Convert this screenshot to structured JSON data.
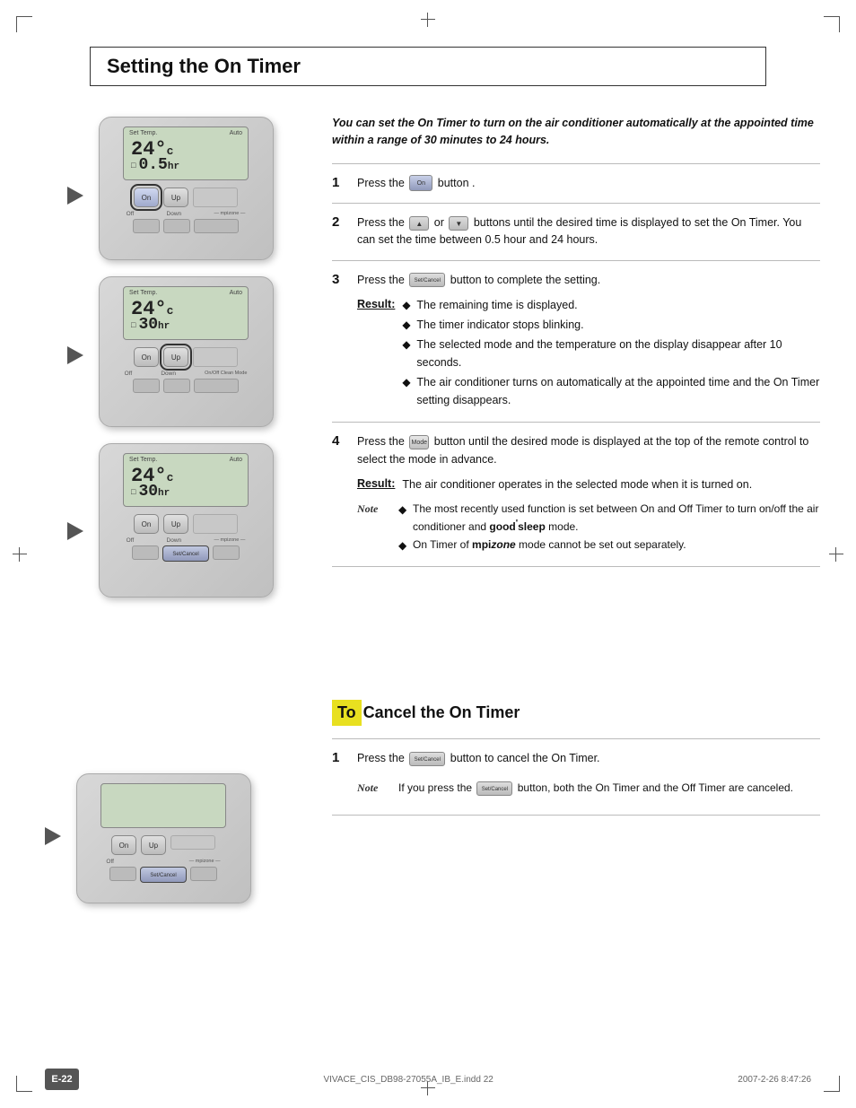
{
  "page": {
    "title": "Setting the On Timer",
    "page_number": "E-22",
    "footer_file": "VIVACE_CIS_DB98-27055A_IB_E.indd  22",
    "footer_date": "2007-2-26  8:47:26"
  },
  "intro": {
    "text": "You can set the On Timer to turn on the air conditioner automatically at the appointed time within a range of 30 minutes to 24 hours."
  },
  "steps": [
    {
      "num": "1",
      "text": "Press the",
      "button_label": "On",
      "text_after": "button ."
    },
    {
      "num": "2",
      "text_before": "Press the",
      "btn1": "Up",
      "text_or": "or",
      "btn2": "Dn",
      "text_after": "buttons until the desired time is displayed to set the On Timer. You can set the time between 0.5 hour and 24 hours."
    },
    {
      "num": "3",
      "text_before": "Press the",
      "btn": "Set/Cancel",
      "text_after": "button to complete the setting.",
      "result_label": "Result:",
      "result_bullets": [
        "The remaining time is displayed.",
        "The timer indicator stops blinking.",
        "The selected mode and the temperature on the display disappear after 10 seconds.",
        "The air conditioner turns on automatically at the appointed time and the On Timer setting disappears."
      ]
    },
    {
      "num": "4",
      "text_before": "Press the",
      "btn": "Mode",
      "text_after": "button until the desired mode is displayed at the top of the remote control to select the mode in advance.",
      "result_label": "Result:",
      "result_text": "The air conditioner operates in the selected mode when it is turned on.",
      "note_label": "Note",
      "note_bullets": [
        "The most recently used function is set between On and Off Timer to turn on/off the air conditioner and good'sleep mode.",
        "On Timer of mpizone mode cannot be set out separately."
      ]
    }
  ],
  "cancel_section": {
    "title_to": "To",
    "title_rest": "Cancel the On Timer",
    "steps": [
      {
        "num": "1",
        "text_before": "Press the",
        "btn": "Set/Cancel",
        "text_after": "button to cancel the On Timer.",
        "note_label": "Note",
        "note_text": "If you press the",
        "note_btn": "Set/Cancel",
        "note_text2": "button, both the On Timer and the Off Timer are canceled."
      }
    ]
  },
  "remote_screens": [
    {
      "id": "remote1",
      "temp": "24°c",
      "timer": "0.5hr",
      "highlight": "on-btn"
    },
    {
      "id": "remote2",
      "temp": "24°c",
      "timer": "30hr",
      "highlight": "up-btn"
    },
    {
      "id": "remote3",
      "temp": "24°c",
      "timer": "30hr",
      "highlight": "setcancel-btn"
    },
    {
      "id": "remote4",
      "temp": "",
      "timer": "",
      "highlight": "setcancel-btn"
    }
  ]
}
